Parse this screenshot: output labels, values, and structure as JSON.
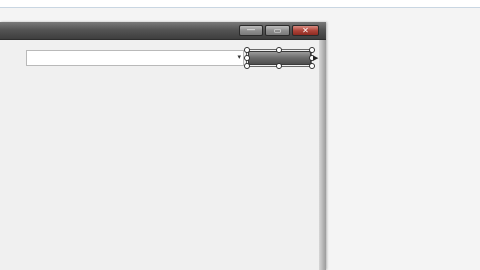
{
  "window": {
    "title": "",
    "caption_buttons": {
      "minimize_glyph": "—",
      "maximize_glyph": "▭",
      "close_glyph": "✕"
    }
  },
  "combo": {
    "value": "",
    "arrow": "▾"
  },
  "selected_control": {
    "label": ""
  }
}
